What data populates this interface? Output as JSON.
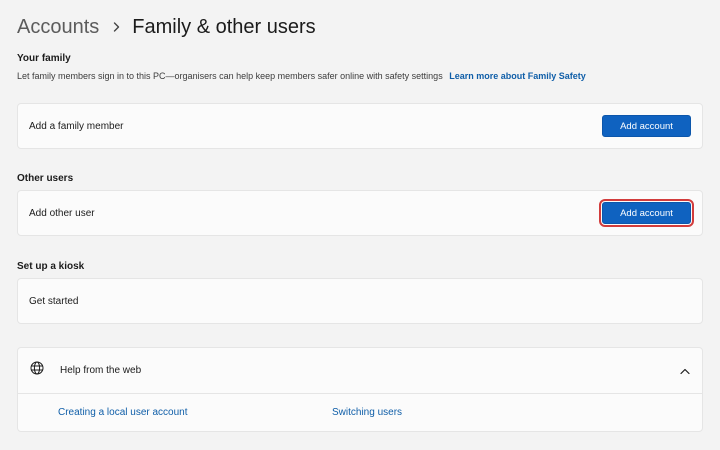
{
  "breadcrumb": {
    "parent": "Accounts",
    "current": "Family & other users"
  },
  "your_family": {
    "title": "Your family",
    "description": "Let family members sign in to this PC—organisers can help keep members safer online with safety settings",
    "learn_more": "Learn more about Family Safety",
    "row_label": "Add a family member",
    "button_label": "Add account"
  },
  "other_users": {
    "title": "Other users",
    "row_label": "Add other user",
    "button_label": "Add account"
  },
  "kiosk": {
    "title": "Set up a kiosk",
    "row_label": "Get started"
  },
  "help": {
    "icon": "globe-icon",
    "title": "Help from the web",
    "links": [
      "Creating a local user account",
      "Switching users"
    ]
  },
  "colors": {
    "accent": "#0f62c0",
    "link": "#0f5ea8",
    "focus_outline": "#d23c3c"
  }
}
